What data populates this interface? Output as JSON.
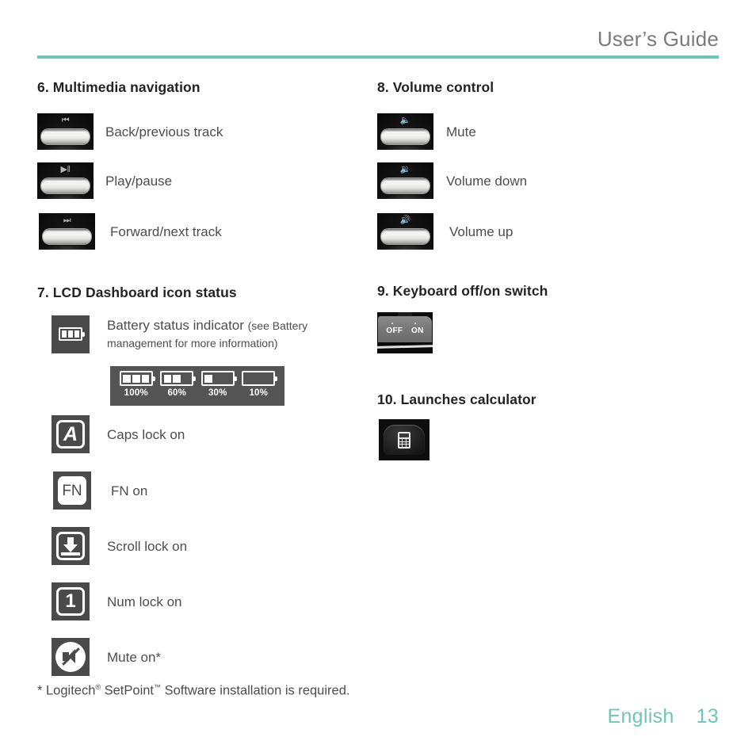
{
  "header": {
    "title": "User’s Guide",
    "rule_color": "#6ec6b8"
  },
  "left_column": {
    "section6": {
      "title": "6. Multimedia navigation",
      "items": [
        {
          "glyph": "prev-track-icon",
          "symbol": "⏮",
          "label": "Back/previous track"
        },
        {
          "glyph": "play-pause-icon",
          "symbol": "▶‖",
          "label": "Play/pause"
        },
        {
          "glyph": "next-track-icon",
          "symbol": "⏭",
          "label": "Forward/next track"
        }
      ]
    },
    "section7": {
      "title": "7. LCD Dashboard icon status",
      "battery_row": {
        "icon": "battery-status-icon",
        "label_main": "Battery status indicator ",
        "label_sub": "(see Battery management for more information)"
      },
      "battery_levels": [
        {
          "pct": "100%",
          "bars": 3
        },
        {
          "pct": "60%",
          "bars": 2
        },
        {
          "pct": "30%",
          "bars": 1
        },
        {
          "pct": "10%",
          "bars": 0
        }
      ],
      "status_items": [
        {
          "icon": "caps-lock-icon",
          "glyph": "A",
          "label": "Caps lock on"
        },
        {
          "icon": "fn-icon",
          "glyph": "FN",
          "label": "FN on"
        },
        {
          "icon": "scroll-lock-icon",
          "glyph": "",
          "label": "Scroll lock on"
        },
        {
          "icon": "num-lock-icon",
          "glyph": "1",
          "label": "Num lock on"
        },
        {
          "icon": "mute-on-icon",
          "glyph": "",
          "label": "Mute on*"
        }
      ]
    }
  },
  "right_column": {
    "section8": {
      "title": "8. Volume control",
      "items": [
        {
          "glyph": "mute-icon",
          "symbol": "🔈",
          "label": "Mute"
        },
        {
          "glyph": "volume-down-icon",
          "symbol": "🔉",
          "label": "Volume down"
        },
        {
          "glyph": "volume-up-icon",
          "symbol": "🔊",
          "label": "Volume up"
        }
      ]
    },
    "section9": {
      "title": "9. Keyboard off/on switch",
      "switch": {
        "off_label": "OFF",
        "on_label": "ON"
      }
    },
    "section10": {
      "title": "10. Launches calculator"
    }
  },
  "footnote": {
    "prefix": "* Logitech",
    "reg": "®",
    "mid": " SetPoint",
    "tm": "™",
    "suffix": " Software installation is required."
  },
  "footer": {
    "language": "English",
    "page": "13",
    "color": "#6ec6b8"
  }
}
